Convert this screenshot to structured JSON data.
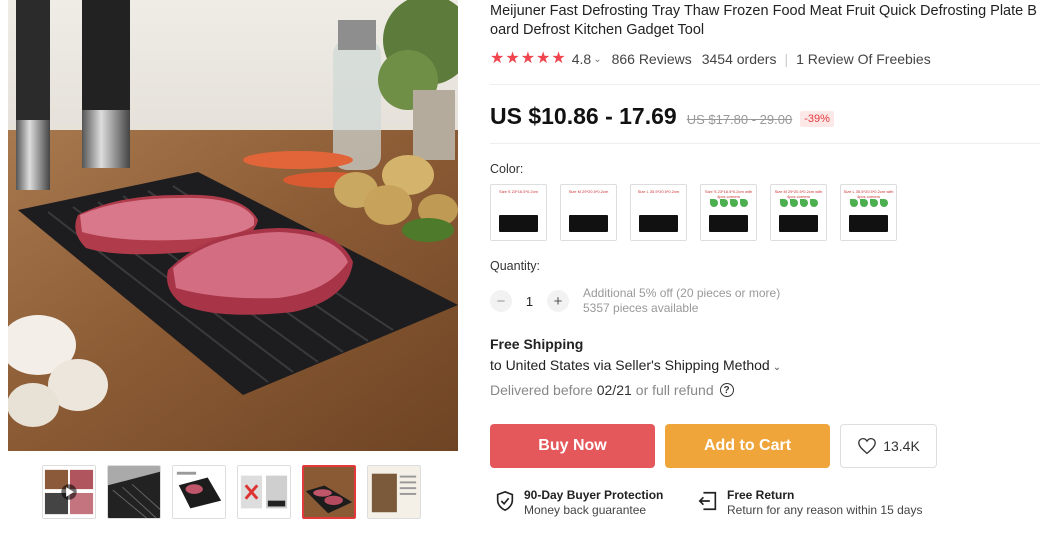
{
  "product": {
    "title": "Meijuner Fast Defrosting Tray Thaw Frozen Food Meat Fruit Quick Defrosting Plate Board Defrost Kitchen Gadget Tool",
    "rating": "4.8",
    "reviews": "866 Reviews",
    "orders": "3454 orders",
    "freebies": "1 Review Of Freebies"
  },
  "price": {
    "current": "US $10.86 - 17.69",
    "original": "US $17.80 - 29.00",
    "discount": "-39%"
  },
  "color": {
    "label": "Color:",
    "options": [
      {
        "caption": "Size S 23*16.5*0.2cm",
        "limes": false,
        "selected": false
      },
      {
        "caption": "Size M 29*20.5*0.2cm",
        "limes": false,
        "selected": false
      },
      {
        "caption": "Size L 35.5*20.5*0.2cm",
        "limes": false,
        "selected": false
      },
      {
        "caption": "Size S 23*16.5*0.2cm with 4pcs corners",
        "limes": true,
        "selected": false
      },
      {
        "caption": "Size M 29*20.5*0.2cm with 4pcs corners",
        "limes": true,
        "selected": false
      },
      {
        "caption": "Size L 35.5*20.5*0.2cm with 4pcs corners",
        "limes": true,
        "selected": false
      }
    ]
  },
  "quantity": {
    "label": "Quantity:",
    "value": "1",
    "minus": "−",
    "plus": "+",
    "offer": "Additional 5% off (20 pieces or more)",
    "available": "5357 pieces available"
  },
  "shipping": {
    "title": "Free Shipping",
    "line": "to United States via Seller's Shipping Method",
    "delivered_prefix": "Delivered before",
    "delivered_date": "02/21",
    "delivered_suffix": "or full refund",
    "help": "?"
  },
  "actions": {
    "buy_now": "Buy Now",
    "add_to_cart": "Add to Cart",
    "wishlist_count": "13.4K"
  },
  "protection": {
    "buyer_title": "90-Day Buyer Protection",
    "buyer_sub": "Money back guarantee",
    "return_title": "Free Return",
    "return_sub": "Return for any reason within 15 days"
  },
  "colors": {
    "star": "#f0444f",
    "buy": "#e4585b",
    "cart": "#f0a53b",
    "discount": "#e4393c"
  },
  "gallery": {
    "active_index": 4,
    "thumbnails": [
      "thumb-video-collage",
      "thumb-tray-closeup",
      "thumb-tray-white",
      "thumb-before-after",
      "thumb-meat-tray",
      "thumb-info-card"
    ]
  }
}
